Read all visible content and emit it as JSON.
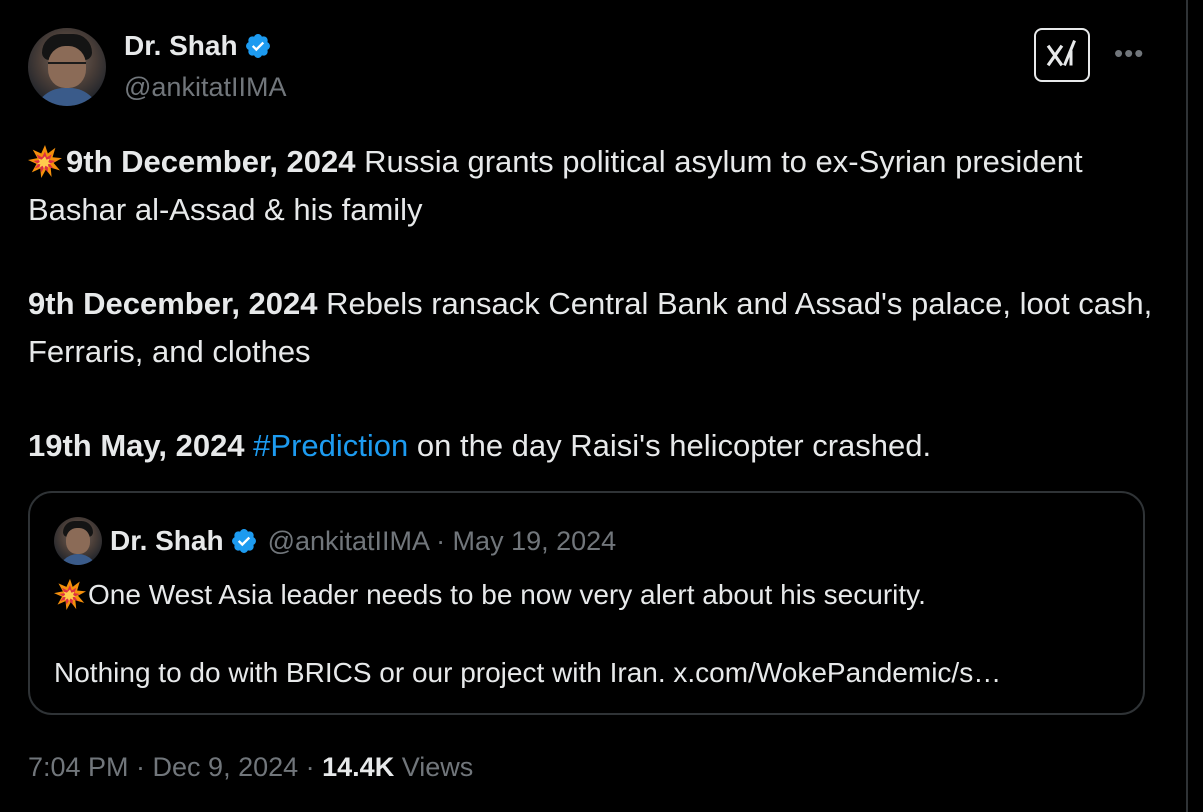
{
  "author": {
    "name": "Dr. Shah",
    "handle": "@ankitatIIMA"
  },
  "tweet": {
    "p1_date": "9th December, 2024",
    "p1_text": " Russia grants political asylum to ex-Syrian president Bashar al-Assad & his family",
    "p2_date": "9th December, 2024",
    "p2_text": " Rebels ransack Central Bank and Assad's palace, loot cash, Ferraris, and clothes",
    "p3_date": "19th May, 2024",
    "p3_hashtag": "#Prediction",
    "p3_text": " on the day Raisi's helicopter crashed."
  },
  "quote": {
    "name": "Dr. Shah",
    "meta": "@ankitatIIMA · May 19, 2024",
    "line1": "One West Asia leader needs to be now very alert about his security.",
    "line2": "Nothing to do with BRICS or our project with Iran. x.com/WokePandemic/s…"
  },
  "footer": {
    "time": "7:04 PM · Dec 9, 2024 · ",
    "views_count": "14.4K",
    "views_label": " Views"
  },
  "icons": {
    "verified": "verified-badge-icon",
    "grok": "grok-icon",
    "more": "more-icon",
    "emoji": "collision-emoji-icon"
  },
  "colors": {
    "background": "#000000",
    "text": "#e7e9ea",
    "muted": "#71767b",
    "accent": "#1d9bf0",
    "border": "#2f3336"
  }
}
